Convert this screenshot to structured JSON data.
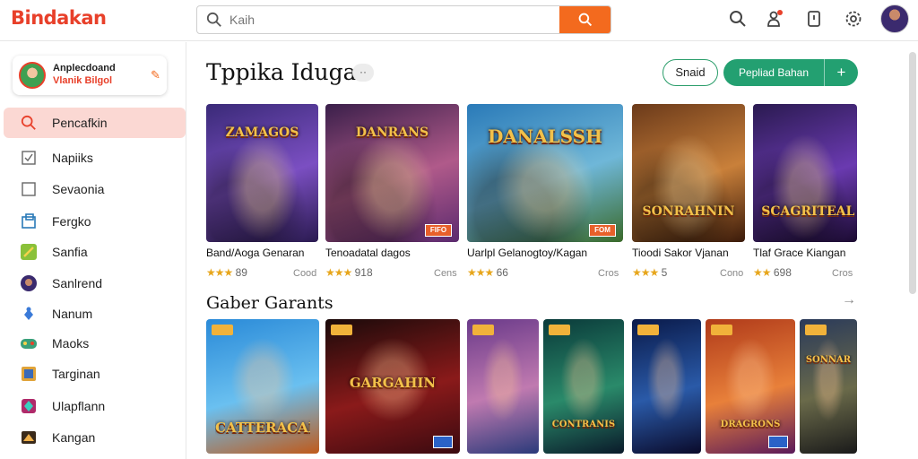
{
  "app": {
    "logo": "Bindakan"
  },
  "search": {
    "placeholder": "Kaih",
    "value": ""
  },
  "topbar": {
    "icons": [
      "search-icon",
      "notification-icon",
      "bookmark-icon",
      "settings-icon",
      "user-avatar"
    ]
  },
  "profile": {
    "line1": "Anplecdoand",
    "line2": "Vlanik Bilgol",
    "edit_icon": "pencil-icon"
  },
  "sidebar": {
    "items": [
      {
        "label": "Pencafkin",
        "icon": "search-icon",
        "active": true
      },
      {
        "label": "Napiiks",
        "icon": "checkbox-icon",
        "active": false
      },
      {
        "label": "Sevaonia",
        "icon": "square-icon",
        "active": false
      },
      {
        "label": "Fergko",
        "icon": "window-icon",
        "active": false
      },
      {
        "label": "Sanfia",
        "icon": "sword-icon",
        "active": false
      },
      {
        "label": "Sanlrend",
        "icon": "helmet-icon",
        "active": false
      },
      {
        "label": "Nanum",
        "icon": "puzzle-icon",
        "active": false
      },
      {
        "label": "Maoks",
        "icon": "gamepad-icon",
        "active": false
      },
      {
        "label": "Targinan",
        "icon": "map-icon",
        "active": false
      },
      {
        "label": "Ulapflann",
        "icon": "crystal-icon",
        "active": false
      },
      {
        "label": "Kangan",
        "icon": "chest-icon",
        "active": false
      }
    ]
  },
  "main": {
    "title": "Tppika Idugat",
    "title_chip": "··",
    "buttons": {
      "small": "Snaid",
      "primary": "Pepliad Bahan",
      "plus": "+"
    }
  },
  "featured": [
    {
      "title": "Band/Aoga Genaran",
      "stars": "★★★",
      "rating": "89",
      "meta": "Cood",
      "logo": "ZAMAGOS",
      "badge": "",
      "colors": [
        "#3a2a78",
        "#7b4fc2",
        "#2a1a50"
      ]
    },
    {
      "title": "Tenoadatal dagos",
      "stars": "★★★",
      "rating": "918",
      "meta": "Cens",
      "logo": "DANRANS",
      "badge": "FIFO",
      "colors": [
        "#3a1f4a",
        "#b05a8a",
        "#5b2a6e"
      ]
    },
    {
      "title": "Uarlpl Gelanogtoy/Kagan",
      "stars": "★★★",
      "rating": "66",
      "meta": "Cros",
      "logo": "DANALSSH",
      "badge": "FOM",
      "colors": [
        "#2a7ab8",
        "#6fb7d8",
        "#3a6a2a"
      ]
    },
    {
      "title": "Tioodi Sakor Vjanan",
      "stars": "★★★",
      "rating": "5",
      "meta": "Cono",
      "logo": "SONRAHNIN",
      "badge": "",
      "colors": [
        "#6b3a1a",
        "#c9803a",
        "#3a1a0a"
      ]
    },
    {
      "title": "Tlaf Grace Kiangan",
      "stars": "★★",
      "rating": "698",
      "meta": "Cros",
      "logo": "SCAGRITEAL",
      "badge": "",
      "colors": [
        "#2a1a50",
        "#6a3ab0",
        "#1a0a30"
      ]
    }
  ],
  "section2": {
    "title": "Gaber Garants",
    "arrow": "→"
  },
  "popular": [
    {
      "logo": "CATTERACANUS",
      "colors": [
        "#2a8ad8",
        "#6ac0f0",
        "#c05a1a"
      ]
    },
    {
      "logo": "GARGAHIN",
      "colors": [
        "#1a0a0a",
        "#8a1a1a",
        "#3a0a10"
      ]
    },
    {
      "logo": "",
      "colors": [
        "#6a3a8a",
        "#c07ab0",
        "#2a3a7a"
      ]
    },
    {
      "logo": "CONTRANIS",
      "colors": [
        "#0a3a3a",
        "#2a8a6a",
        "#0a1a2a"
      ]
    },
    {
      "logo": "",
      "colors": [
        "#0a1a4a",
        "#2a5aa8",
        "#0a0a2a"
      ]
    },
    {
      "logo": "DRAGRONS",
      "colors": [
        "#b03a1a",
        "#e8803a",
        "#5a1a5a"
      ]
    },
    {
      "logo": "SONNAR",
      "colors": [
        "#2a3a5a",
        "#6a6a4a",
        "#1a1a1a"
      ]
    }
  ],
  "colors": {
    "brand": "#e8402a",
    "accent": "#f36a1e",
    "green": "#23a071",
    "active_nav": "#fbd8d3"
  }
}
